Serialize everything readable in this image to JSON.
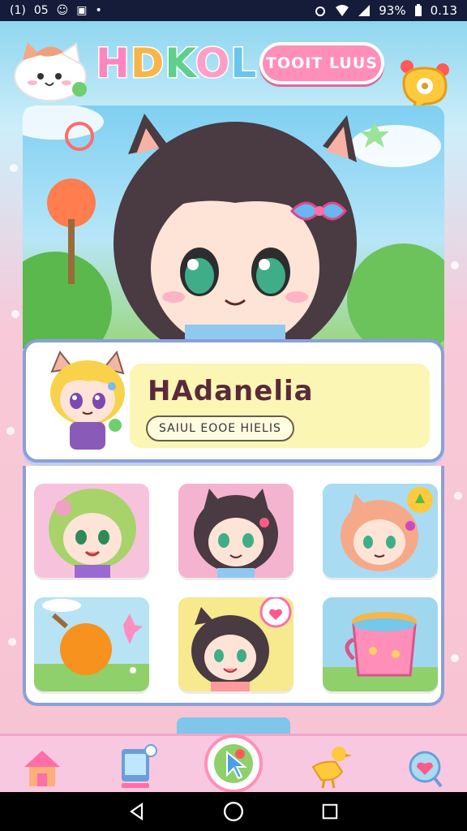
{
  "status_bar": {
    "left_icons": [
      "(1)",
      "05",
      "☺",
      "▣",
      "•"
    ],
    "battery_text": "93%",
    "time": "0.13"
  },
  "header": {
    "app_title_letters": [
      "H",
      "D",
      "K",
      "O",
      "L"
    ],
    "pill_button_label": "TOOIT LUUS"
  },
  "profile": {
    "name": "HAdanelia",
    "tag": "SAIUL EOOE HIELIS"
  },
  "grid": {
    "tiles": [
      {
        "name": "dino-hood-girl",
        "bg": "#f7c3dc"
      },
      {
        "name": "cat-ear-girl",
        "bg": "#f4b4cf"
      },
      {
        "name": "peach-hair-girl",
        "bg": "#a9dcf2"
      },
      {
        "name": "orange-fruit",
        "bg": "#b7e3f5"
      },
      {
        "name": "heart-bubble-girl",
        "bg": "#f6e98e"
      },
      {
        "name": "fruit-tea-cup",
        "bg": "#9fd7ef"
      }
    ]
  },
  "colors": {
    "accent_pink": "#ff8eb8",
    "panel_border": "#8aa0d8",
    "name_panel": "#fbf6b4"
  },
  "bottom_nav": {
    "items": [
      "home-icon",
      "tablet-icon",
      "cursor-icon",
      "duck-icon",
      "heart-chat-icon"
    ]
  }
}
